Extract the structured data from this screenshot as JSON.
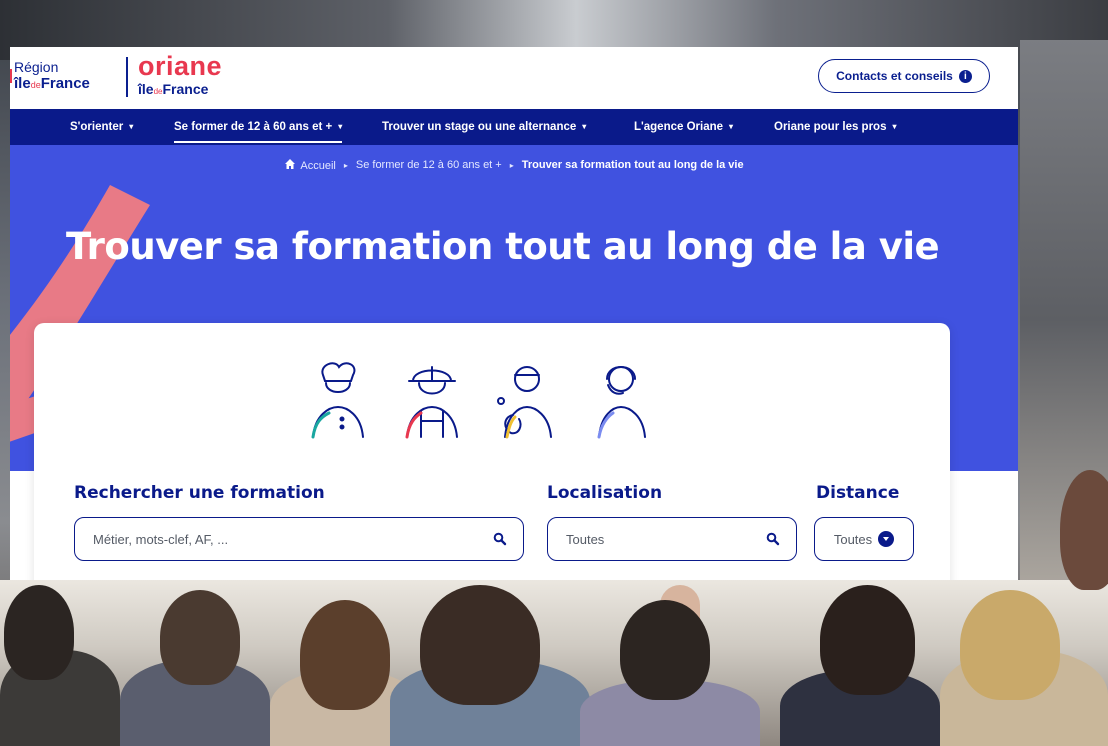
{
  "header": {
    "region_logo": {
      "line1": "Région",
      "line2_a": "île",
      "line2_de": "de",
      "line2_b": "France"
    },
    "oriane_logo": {
      "line1": "oriane",
      "line2_a": "île",
      "line2_de": "de",
      "line2_b": "France"
    },
    "contact_button": "Contacts et conseils"
  },
  "nav": {
    "items": [
      {
        "label": "S'orienter"
      },
      {
        "label": "Se former de 12 à 60 ans et +",
        "active": true
      },
      {
        "label": "Trouver un stage ou une alternance"
      },
      {
        "label": "L'agence Oriane"
      },
      {
        "label": "Oriane pour les pros"
      }
    ]
  },
  "breadcrumb": {
    "home": "Accueil",
    "level2": "Se former de 12 à 60 ans et +",
    "current": "Trouver sa formation tout au long de la vie"
  },
  "hero": {
    "title": "Trouver sa formation tout au long de la vie"
  },
  "search": {
    "formation_label": "Rechercher une formation",
    "formation_placeholder": "Métier, mots-clef, AF, ...",
    "location_label": "Localisation",
    "location_value": "Toutes",
    "distance_label": "Distance",
    "distance_value": "Toutes"
  },
  "colors": {
    "brand_navy": "#0a1a8a",
    "hero_blue": "#4052e0",
    "accent_red": "#e8384f",
    "swoosh_pink": "#e87a86"
  },
  "icons": [
    "home-icon",
    "search-icon",
    "info-icon",
    "chevron-down-icon",
    "chef-avatar-icon",
    "worker-avatar-icon",
    "doctor-avatar-icon",
    "operator-avatar-icon"
  ]
}
